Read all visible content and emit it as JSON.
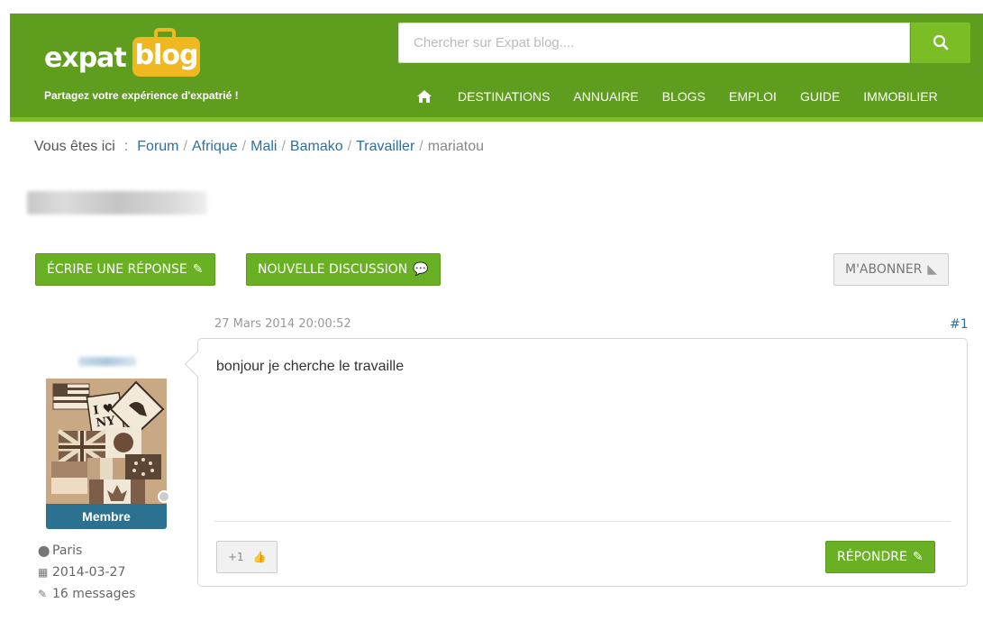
{
  "header": {
    "logo_word1": "expat",
    "logo_word2": "blog",
    "tagline": "Partagez votre expérience d'expatrié !",
    "search_placeholder": "Chercher sur Expat blog....",
    "nav": [
      "DESTINATIONS",
      "ANNUAIRE",
      "BLOGS",
      "EMPLOI",
      "GUIDE",
      "IMMOBILIER"
    ]
  },
  "breadcrumb": {
    "prefix": "Vous êtes ici",
    "items": [
      "Forum",
      "Afrique",
      "Mali",
      "Bamako",
      "Travailler"
    ],
    "current": "mariatou"
  },
  "actions": {
    "write_reply": "ÉCRIRE UNE RÉPONSE",
    "new_discussion": "NOUVELLE DISCUSSION",
    "subscribe": "M'ABONNER"
  },
  "post": {
    "date": "27 Mars 2014 20:00:52",
    "number": "#1",
    "message": "bonjour je cherche le travaille",
    "plus_one": "+1",
    "reply": "RÉPONDRE"
  },
  "author": {
    "role": "Membre",
    "location": "Paris",
    "joined": "2014-03-27",
    "messages": "16 messages",
    "avatar_text": "I NY"
  },
  "colors": {
    "header_green": "#5f9d1e",
    "accent_green": "#6ab024",
    "link_blue": "#2f6f9f",
    "role_blue": "#2c7190"
  }
}
